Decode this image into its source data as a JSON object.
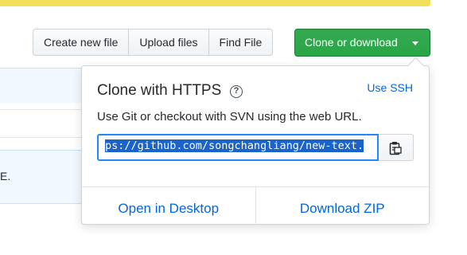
{
  "toolbar": {
    "create_label": "Create new file",
    "upload_label": "Upload files",
    "find_label": "Find File",
    "clone_label": "Clone or download"
  },
  "file_list": {
    "partial_text": "E."
  },
  "clone_panel": {
    "title": "Clone with HTTPS",
    "help_symbol": "?",
    "use_ssh": "Use SSH",
    "description": "Use Git or checkout with SVN using the web URL.",
    "url_visible": "ps://github.com/songchangliang/new-text.",
    "open_desktop": "Open in Desktop",
    "download_zip": "Download ZIP"
  },
  "colors": {
    "accent": "#0366d6",
    "clone_button": "#28a745",
    "selection": "#1a63c9",
    "strip": "#f3e05a"
  }
}
